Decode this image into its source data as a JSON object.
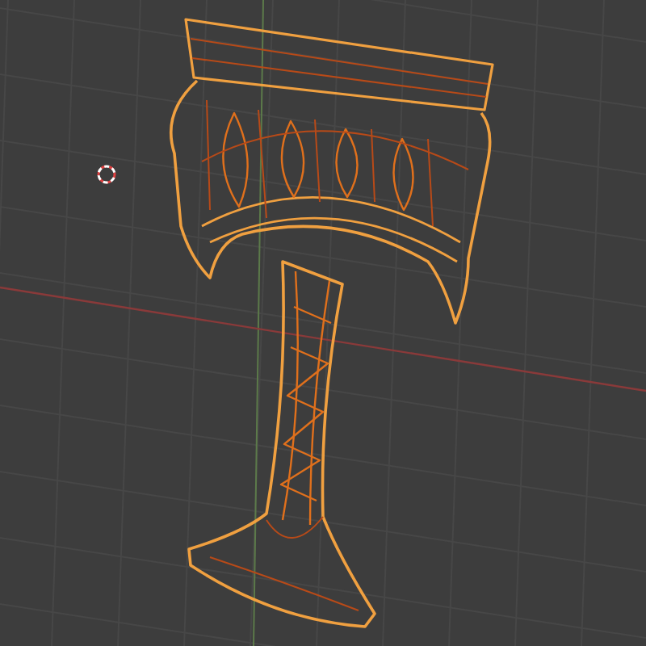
{
  "viewport": {
    "kind": "wireframe",
    "mesh": {
      "selected": true
    }
  }
}
